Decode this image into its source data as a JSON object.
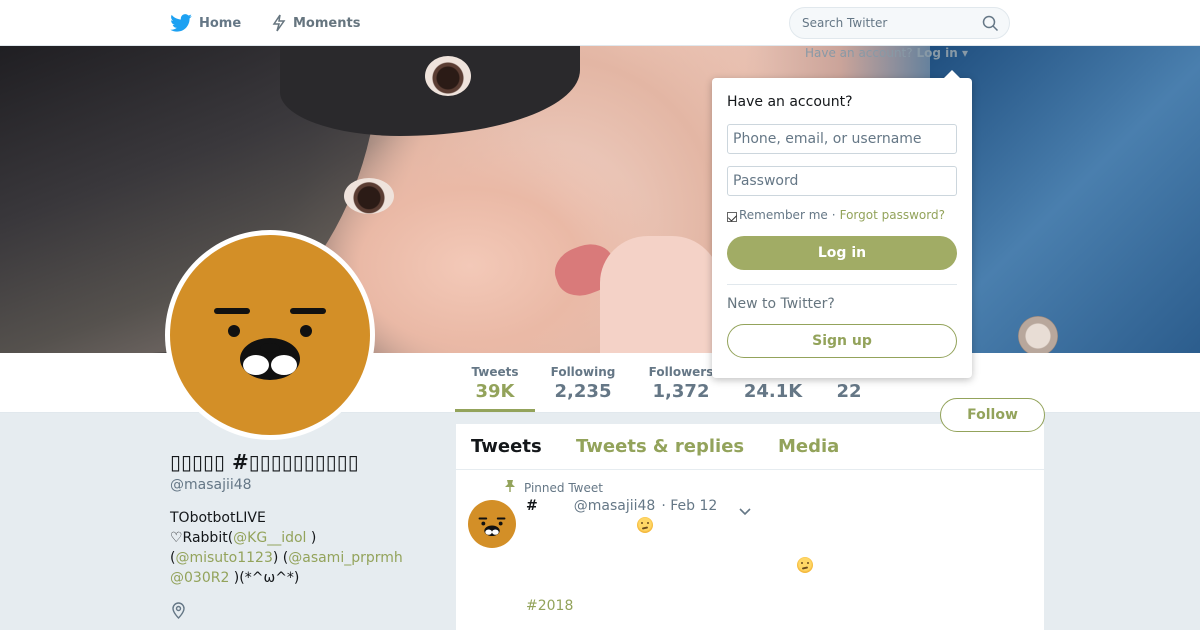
{
  "nav": {
    "home_label": "Home",
    "moments_label": "Moments",
    "search_placeholder": "Search Twitter"
  },
  "login_hint": {
    "prompt": "Have an account?",
    "toggle_label": "Log in"
  },
  "login_dropdown": {
    "heading": "Have an account?",
    "username_placeholder": "Phone, email, or username",
    "password_placeholder": "Password",
    "remember_label": "Remember me",
    "separator": "·",
    "forgot_label": "Forgot password?",
    "login_button": "Log in",
    "new_heading": "New to Twitter?",
    "signup_button": "Sign up"
  },
  "stats": [
    {
      "label": "Tweets",
      "value": "39K"
    },
    {
      "label": "Following",
      "value": "2,235"
    },
    {
      "label": "Followers",
      "value": "1,372"
    },
    {
      "label": "",
      "value": "24.1K"
    },
    {
      "label": "",
      "value": "22"
    }
  ],
  "follow_button": "Follow",
  "profile": {
    "name": "▯▯▯▯▯ #▯▯▯▯▯▯▯▯▯▯",
    "handle": "@masajii48",
    "bio_line1": "TObotbotLIVE",
    "bio_line2_pre": "♡Rabbit(",
    "bio_link1": "@KG__idol",
    "bio_line2_post": " )",
    "bio_line3_pre": "(",
    "bio_link2": "@misuto1123",
    "bio_line3_mid": ") (",
    "bio_link3": "@asami_prprmh",
    "bio_link4": "@030R2",
    "bio_line4_post": " )(*^ω^*)"
  },
  "timeline": {
    "tabs": [
      "Tweets",
      "Tweets & replies",
      "Media"
    ],
    "pinned_label": "Pinned Tweet",
    "tweet": {
      "name": "#",
      "handle": "@masajii48",
      "date": "· Feb 12",
      "hashtag": "#2018"
    }
  },
  "colors": {
    "accent": "#93a35b",
    "login_button": "#a1ac65",
    "avatar": "#d38f27",
    "nav_icon": "#1da1f2"
  }
}
